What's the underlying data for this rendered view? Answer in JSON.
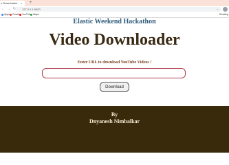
{
  "browser": {
    "tab_title": "o Downloader",
    "tab_close": "×",
    "new_tab": "+",
    "nav_icons": "← → ↻",
    "url": "127.0.0.1:5000",
    "star_icon": "☆",
    "bookmarks": [
      {
        "label": "Apps",
        "color": "#4285f4"
      },
      {
        "label": "Gmail",
        "color": "#ea4335"
      },
      {
        "label": "YouTube",
        "color": "#ff0000"
      },
      {
        "label": "Maps",
        "color": "#34a853"
      }
    ],
    "reading_list": "Reading"
  },
  "page": {
    "hackathon_title": "Elastic Weekend Hackathon",
    "main_title": "Video Downloader",
    "prompt": "Enter URL to download YouTube Videos !",
    "input_value": "",
    "input_placeholder": "",
    "download_label": "Download"
  },
  "footer": {
    "by_label": "By",
    "author": "Dnyanesh Nimbalkar"
  },
  "colors": {
    "footer_bg": "#3a2a0c",
    "title": "#3a2a14",
    "hackathon": "#2f5d7c",
    "prompt": "#7a3b1a",
    "input_border": "#b03a4a"
  }
}
